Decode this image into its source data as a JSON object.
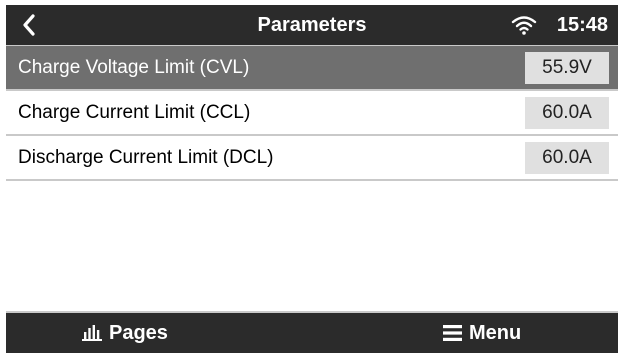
{
  "header": {
    "title": "Parameters",
    "time": "15:48",
    "back_icon": "chevron-left-icon",
    "wifi_icon": "wifi-icon"
  },
  "rows": [
    {
      "label": "Charge Voltage Limit (CVL)",
      "value": "55.9V",
      "selected": true
    },
    {
      "label": "Charge Current Limit (CCL)",
      "value": "60.0A",
      "selected": false
    },
    {
      "label": "Discharge Current Limit (DCL)",
      "value": "60.0A",
      "selected": false
    }
  ],
  "footer": {
    "pages_label": "Pages",
    "pages_icon": "bar-chart-icon",
    "menu_label": "Menu",
    "menu_icon": "hamburger-icon"
  },
  "colors": {
    "bar_bg": "#2b2b2b",
    "selected_row_bg": "#6f6f6f",
    "value_box_bg": "#e0e0e0",
    "separator": "#c9c9c9"
  }
}
